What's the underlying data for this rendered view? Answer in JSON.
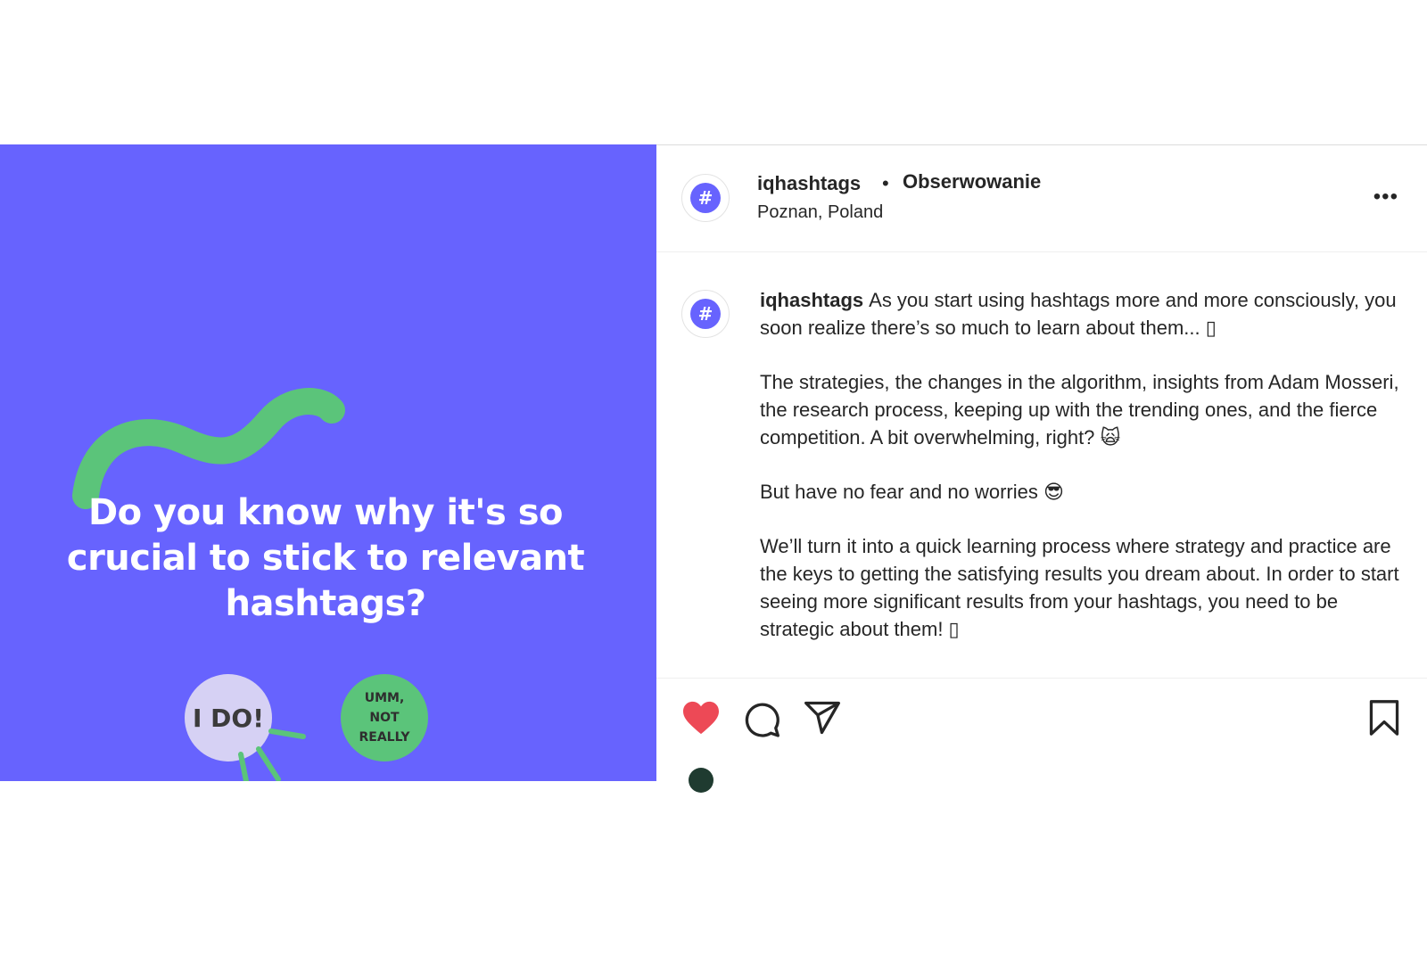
{
  "media": {
    "headline": "Do you know why it's so crucial to stick to relevant hashtags?",
    "answer_yes": "I DO!",
    "answer_no": "UMM, NOT REALLY",
    "colors": {
      "background": "#6763fe",
      "accent_green": "#5bc47a",
      "bubble_lilac": "#d6d1f4"
    }
  },
  "header": {
    "avatar_icon": "hash-icon",
    "avatar_glyph": "#",
    "username": "iqhashtags",
    "separator": "•",
    "follow_status": "Obserwowanie",
    "location": "Poznan, Poland",
    "more_icon": "more-options-icon",
    "more_glyph": "•••"
  },
  "caption": {
    "username": "iqhashtags",
    "paragraphs": [
      "As you start using hashtags more and more consciously, you soon realize there’s so much to learn about them... ▯",
      "The strategies, the changes in the algorithm, insights from Adam Mosseri, the research process, keeping up with the trending ones, and the fierce competition. A bit overwhelming, right? 🙀",
      "But have no fear and no worries 😎",
      "We’ll turn it into a quick learning process where strategy and practice are the keys to getting the satisfying results you dream about. In order to start seeing more significant results from your hashtags, you need to be strategic about them! ▯"
    ]
  },
  "actions": {
    "like_icon": "heart-filled-icon",
    "comment_icon": "comment-icon",
    "share_icon": "paper-plane-icon",
    "save_icon": "bookmark-icon",
    "like_color": "#ed4956"
  }
}
